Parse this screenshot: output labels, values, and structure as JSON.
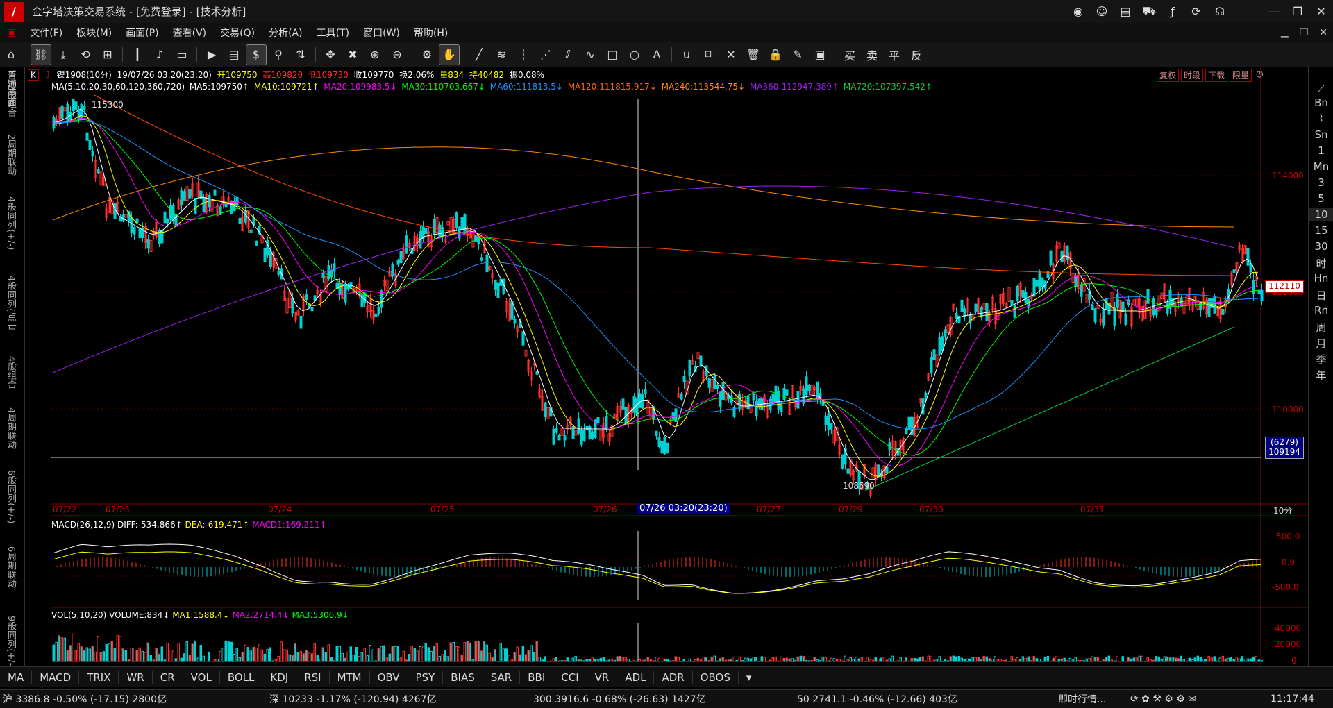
{
  "window": {
    "title": "金字塔决策交易系统 - [免费登录] - [技术分析]"
  },
  "menu": [
    "文件(F)",
    "板块(M)",
    "画面(P)",
    "查看(V)",
    "交易(Q)",
    "分析(A)",
    "工具(T)",
    "窗口(W)",
    "帮助(H)"
  ],
  "toolbar": {
    "trade_buttons": [
      "买",
      "卖",
      "平",
      "反"
    ]
  },
  "left_tabs": [
    "12般组合",
    "2周期联动",
    "4般同列(+/-)",
    "4般同列(点击",
    "4般组合",
    "4周期联动",
    "6般同列(+/-)",
    "6周期联动",
    "9般同列(+/-)"
  ],
  "left_top_tab": "普通画面",
  "periods": [
    "Bn",
    "Sn",
    "1",
    "Mn",
    "3",
    "5",
    "10",
    "15",
    "30",
    "时",
    "Hn",
    "日",
    "Rn",
    "周",
    "月",
    "季",
    "年"
  ],
  "selected_period": "10",
  "header": {
    "k_label": "K",
    "symbol": "镍1908(10分)",
    "datetime": "19/07/26 03:20(23:20)",
    "open": "开109750",
    "high": "高109820",
    "low": "低109730",
    "close": "收109770",
    "turnover": "换2.06%",
    "volume": "量834",
    "oi": "持40482",
    "amplitude": "振0.08%"
  },
  "ma_legend": {
    "title": "MA(5,10,20,30,60,120,360,720)",
    "items": [
      {
        "text": "MA5:109750↑",
        "color": "#ffffff"
      },
      {
        "text": "MA10:109721↑",
        "color": "#ffff00"
      },
      {
        "text": "MA20:109983.5↓",
        "color": "#ff00ff"
      },
      {
        "text": "MA30:110703.667↓",
        "color": "#00ff00"
      },
      {
        "text": "MA60:111813.5↓",
        "color": "#1e90ff"
      },
      {
        "text": "MA120:111815.917↓",
        "color": "#ff6a00"
      },
      {
        "text": "MA240:113544.75↓",
        "color": "#ff8c00"
      },
      {
        "text": "MA360:112947.389↑",
        "color": "#a020f0"
      },
      {
        "text": "MA720:107397.542↑",
        "color": "#00cc44"
      }
    ]
  },
  "top_buttons": [
    "复权",
    "时段",
    "下载",
    "限量"
  ],
  "price_axis": [
    "114000",
    "112000",
    "110000"
  ],
  "current_price_tag": "112110",
  "cursor_tag": {
    "line1": "(6279)",
    "line2": "109194"
  },
  "annotations": {
    "high": "115300",
    "low": "108590"
  },
  "time_axis": [
    "07/22",
    "07/23",
    "07/24",
    "07/25",
    "07/26",
    "07/26 03:20(23:20)",
    "07/27",
    "07/29",
    "07/30",
    "07/31"
  ],
  "period_label": "10分",
  "macd": {
    "title": "MACD(26,12,9)",
    "diff": "DIFF:-534.866↑",
    "dea": "DEA:-619.471↑",
    "macd1": "MACD1:169.211↑",
    "axis": [
      "500.0",
      "0.0",
      "-500.0"
    ]
  },
  "vol": {
    "title": "VOL(5,10,20)",
    "volume": "VOLUME:834↓",
    "ma1": "MA1:1588.4↓",
    "ma2": "MA2:2714.4↓",
    "ma3": "MA3:5306.9↓",
    "axis": [
      "40000",
      "20000",
      "0"
    ]
  },
  "indicator_tabs": [
    "MA",
    "MACD",
    "TRIX",
    "WR",
    "CR",
    "VOL",
    "BOLL",
    "KDJ",
    "RSI",
    "MTM",
    "OBV",
    "PSY",
    "BIAS",
    "SAR",
    "BBI",
    "CCI",
    "VR",
    "ADL",
    "ADR",
    "OBOS"
  ],
  "status": {
    "sh": "沪 3386.8 -0.50% (-17.15) 2800亿",
    "sz": "深 10233 -1.17% (-120.94) 4267亿",
    "i300": "300 3916.6 -0.68% (-26.63) 1427亿",
    "i50": "50 2741.1 -0.46% (-12.66) 403亿",
    "quote_btn": "即时行情...",
    "clock": "11:17:44"
  },
  "colors": {
    "up": "#ff3030",
    "down": "#00d0d0",
    "axis": "#8b0000"
  }
}
